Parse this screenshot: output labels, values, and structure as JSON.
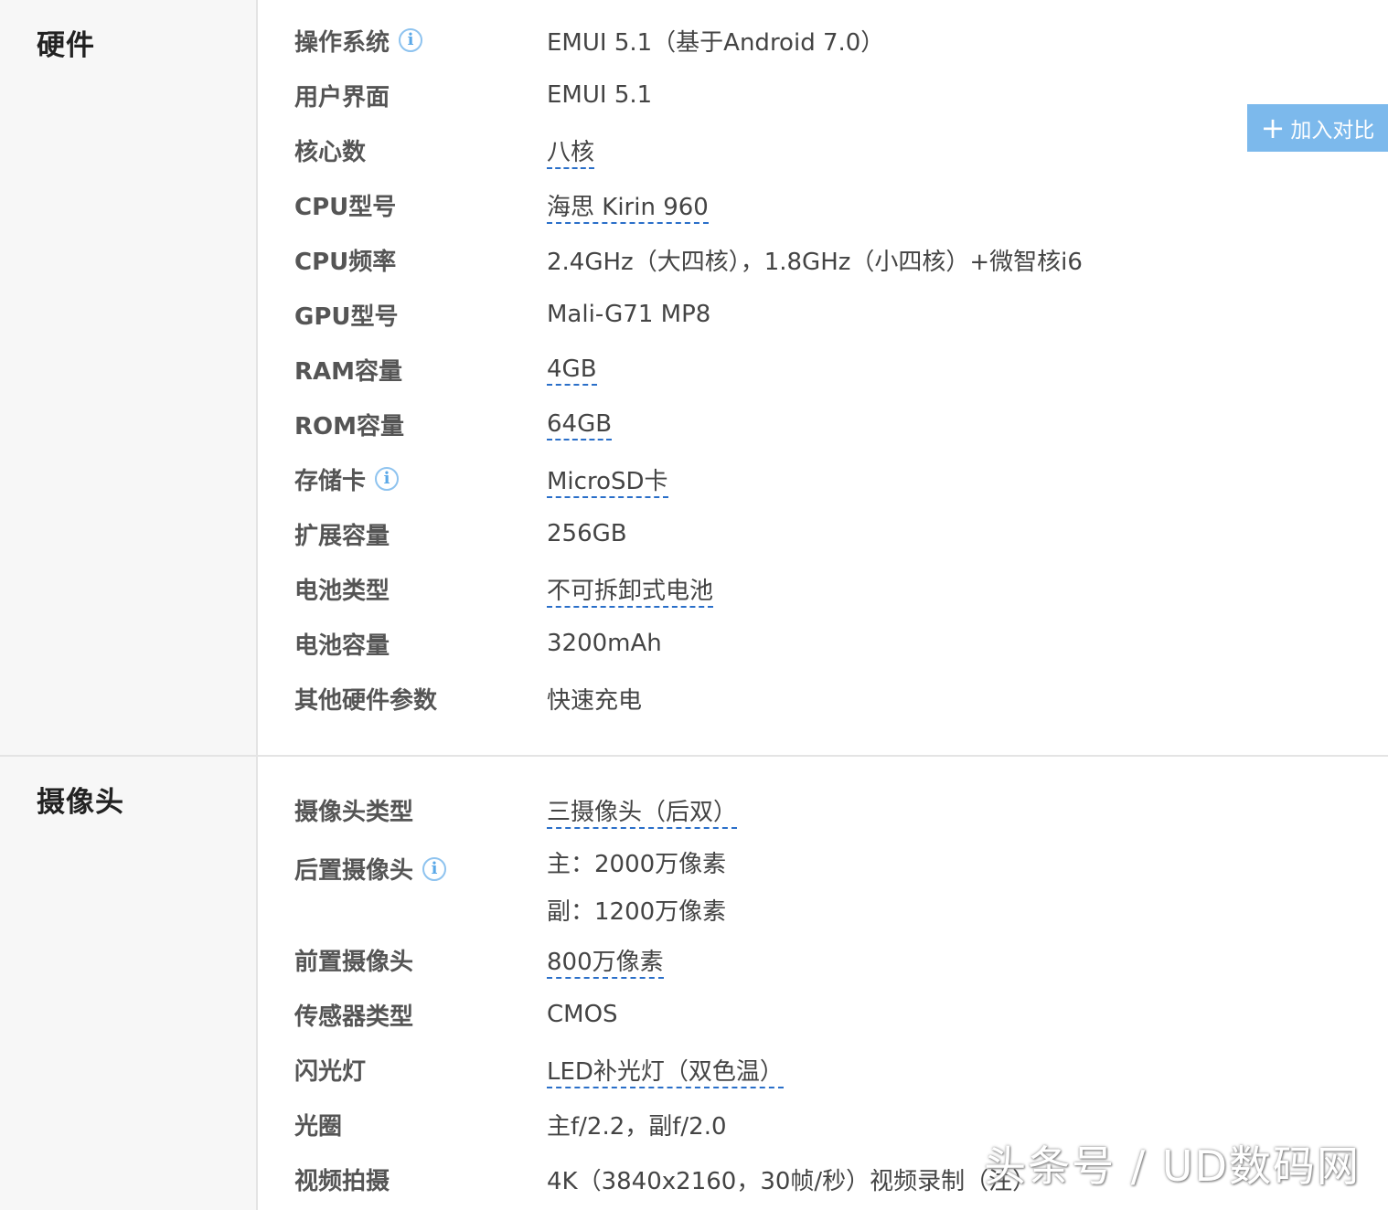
{
  "compare": {
    "plus": "+",
    "label": "加入对比"
  },
  "watermark": "头条号 / UD数码网",
  "hardware": {
    "title": "硬件",
    "rows": [
      "操作系统",
      "EMUI 5.1（基于Android 7.0）",
      "用户界面",
      "EMUI 5.1",
      "核心数",
      "八核",
      "CPU型号",
      "海思 Kirin 960",
      "CPU频率",
      "2.4GHz（大四核），1.8GHz（小四核）+微智核i6",
      "GPU型号",
      "Mali-G71 MP8",
      "RAM容量",
      "4GB",
      "ROM容量",
      "64GB",
      "存储卡",
      "MicroSD卡",
      "扩展容量",
      "256GB",
      "电池类型",
      "不可拆卸式电池",
      "电池容量",
      "3200mAh",
      "其他硬件参数",
      "快速充电"
    ]
  },
  "camera": {
    "title": "摄像头",
    "rows": [
      "摄像头类型",
      "三摄像头（后双）",
      "后置摄像头",
      "主：2000万像素",
      "副：1200万像素",
      "前置摄像头",
      "800万像素",
      "传感器类型",
      "CMOS",
      "闪光灯",
      "LED补光灯（双色温）",
      "光圈",
      "主f/2.2，副f/2.0",
      "视频拍摄",
      "4K（3840x2160，30帧/秒）视频录制（注）"
    ]
  },
  "info_glyph": "i"
}
